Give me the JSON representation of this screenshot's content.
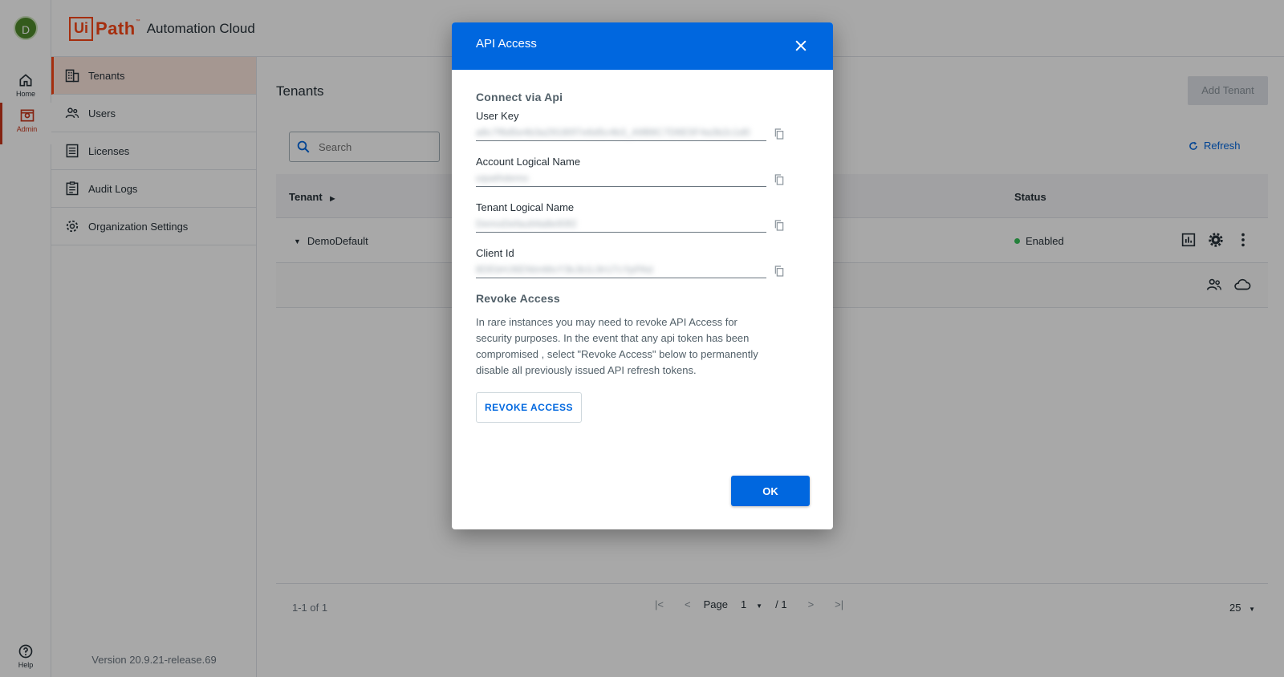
{
  "rail": {
    "avatar_initial": "D",
    "home_label": "Home",
    "admin_label": "Admin",
    "help_label": "Help"
  },
  "header": {
    "logo_ui": "Ui",
    "logo_path": "Path",
    "logo_tm": "™",
    "product_name": "Automation Cloud"
  },
  "sidebar": {
    "items": [
      {
        "label": "Tenants",
        "icon": "building-icon"
      },
      {
        "label": "Users",
        "icon": "users-icon"
      },
      {
        "label": "Licenses",
        "icon": "list-icon"
      },
      {
        "label": "Audit Logs",
        "icon": "clipboard-icon"
      },
      {
        "label": "Organization Settings",
        "icon": "gear-icon"
      }
    ],
    "version": "Version 20.9.21-release.69"
  },
  "main": {
    "title": "Tenants",
    "add_button": "Add Tenant",
    "search_placeholder": "Search",
    "refresh_label": "Refresh",
    "columns": {
      "tenant": "Tenant",
      "status": "Status"
    },
    "rows": [
      {
        "name": "DemoDefault",
        "status": "Enabled"
      }
    ],
    "pager": {
      "count": "1-1 of 1",
      "page_label": "Page",
      "page": "1",
      "total": "/ 1",
      "page_size": "25"
    }
  },
  "dialog": {
    "title": "API Access",
    "connect_heading": "Connect via Api",
    "fields": [
      {
        "label": "User Key",
        "value": "a8c7f6d5e4b3a29180f7e6d5c4b3_A9B8C7D6E5F4a3b2c1d0"
      },
      {
        "label": "Account Logical Name",
        "value": "uipathdemo"
      },
      {
        "label": "Tenant Logical Name",
        "value": "DemoDefault4a8e93f2"
      },
      {
        "label": "Client Id",
        "value": "8DEbHJ6ENtmMxY3kJb1L9rU7cYpPAd"
      }
    ],
    "revoke_heading": "Revoke Access",
    "revoke_text": "In rare instances you may need to revoke API Access for security purposes. In the event that any api token has been compromised , select \"Revoke Access\" below to permanently disable all previously issued API refresh tokens.",
    "revoke_button": "REVOKE ACCESS",
    "ok_button": "OK"
  },
  "colors": {
    "primary_blue": "#0067df",
    "brand_orange": "#fa4616",
    "status_green": "#38c25a"
  }
}
